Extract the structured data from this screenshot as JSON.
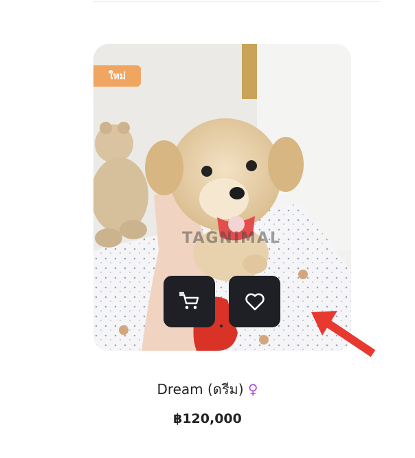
{
  "product": {
    "badge": "ใหม่",
    "watermark": "TAGNIMAL",
    "name": "Dream (ดรีม)",
    "gender_symbol": "♀",
    "price": "฿120,000"
  },
  "colors": {
    "badge": "#f0a561",
    "action_button": "#1f2025",
    "gender_symbol": "#b04fe0",
    "annotation_arrow": "#e8392f"
  },
  "icons": {
    "cart": "shopping-cart-icon",
    "wishlist": "heart-icon"
  }
}
